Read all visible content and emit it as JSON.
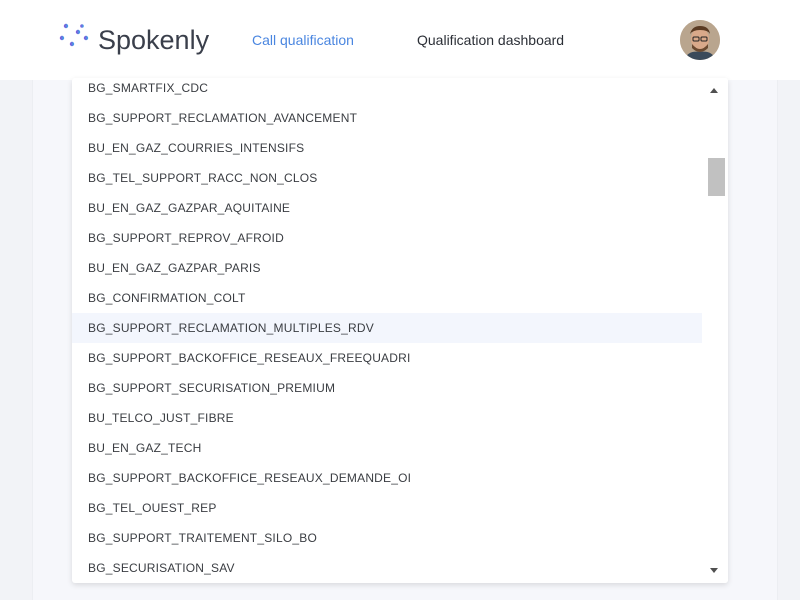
{
  "header": {
    "brand": "Spokenly",
    "nav": {
      "call_qualification": "Call qualification",
      "qualification_dashboard": "Qualification dashboard"
    },
    "accent_color": "#4a86e0"
  },
  "dropdown": {
    "highlighted_item": "BG_SUPPORT_RECLAMATION_MULTIPLES_RDV",
    "items": [
      "BG_SMARTFIX_CDC",
      "BG_SUPPORT_RECLAMATION_AVANCEMENT",
      "BU_EN_GAZ_COURRIES_INTENSIFS",
      "BG_TEL_SUPPORT_RACC_NON_CLOS",
      "BU_EN_GAZ_GAZPAR_AQUITAINE",
      "BG_SUPPORT_REPROV_AFROID",
      "BU_EN_GAZ_GAZPAR_PARIS",
      "BG_CONFIRMATION_COLT",
      "BG_SUPPORT_RECLAMATION_MULTIPLES_RDV",
      "BG_SUPPORT_BACKOFFICE_RESEAUX_FREEQUADRI",
      "BG_SUPPORT_SECURISATION_PREMIUM",
      "BU_TELCO_JUST_FIBRE",
      "BU_EN_GAZ_TECH",
      "BG_SUPPORT_BACKOFFICE_RESEAUX_DEMANDE_OI",
      "BG_TEL_OUEST_REP",
      "BG_SUPPORT_TRAITEMENT_SILO_BO",
      "BG_SECURISATION_SAV"
    ]
  }
}
